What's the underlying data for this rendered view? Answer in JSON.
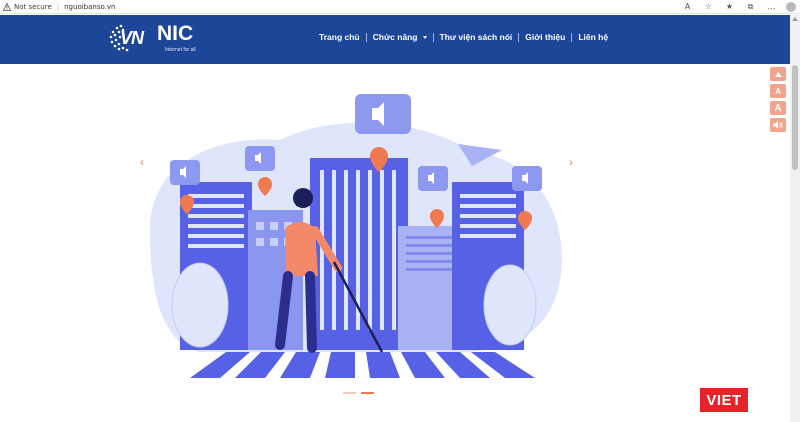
{
  "browser": {
    "security_label": "Not secure",
    "url": "nguoibanso.vn"
  },
  "logo": {
    "vn": "VN",
    "nic": "NIC",
    "tagline": "Internet for all"
  },
  "nav": {
    "items": [
      {
        "label": "Trang chủ"
      },
      {
        "label": "Chức năng"
      },
      {
        "label": "Thư viện sách nói"
      },
      {
        "label": "Giới thiệu"
      },
      {
        "label": "Liên hệ"
      }
    ]
  },
  "accessibility": {
    "buttons": [
      {
        "label": ""
      },
      {
        "label": "A"
      },
      {
        "label": "A"
      },
      {
        "label": ""
      }
    ]
  },
  "carousel": {
    "prev_label": "‹",
    "next_label": "›",
    "slide_count": 2,
    "active_index": 1
  },
  "badge": {
    "label": "VIET"
  },
  "colors": {
    "header": "#1d4598",
    "accent": "#ef7a52",
    "illustration_primary": "#5661e6",
    "illustration_light": "#dfe6fb"
  }
}
